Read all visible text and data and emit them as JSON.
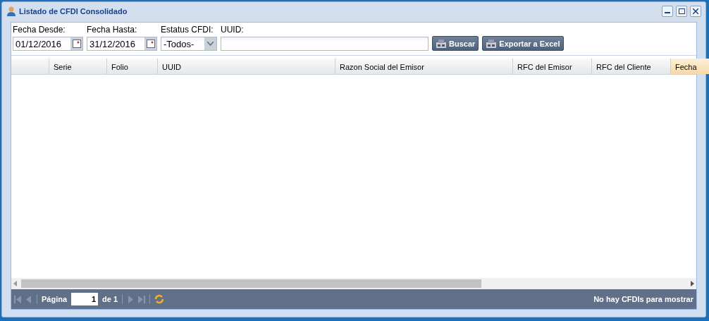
{
  "window": {
    "title": "Listado de CFDI Consolidado"
  },
  "filters": [
    {
      "label": "Fecha Desde:",
      "kind": "date",
      "value": "01/12/2016"
    },
    {
      "label": "Fecha Hasta:",
      "kind": "date",
      "value": "31/12/2016"
    },
    {
      "label": "Estatus CFDI:",
      "kind": "select",
      "value": "-Todos-"
    },
    {
      "label": "UUID:",
      "kind": "text"
    }
  ],
  "buttons": [
    "Buscar",
    "Exportar a Excel"
  ],
  "table": {
    "columns": [
      {
        "highlighted": false
      },
      {
        "label": "Serie",
        "highlighted": false
      },
      {
        "label": "Folio",
        "highlighted": false
      },
      {
        "label": "UUID",
        "highlighted": false
      },
      {
        "label": "Razon Social del Emisor",
        "highlighted": false
      },
      {
        "label": "RFC del Emisor",
        "highlighted": false
      },
      {
        "label": "RFC del Cliente",
        "highlighted": false
      },
      {
        "label": "Fecha",
        "highlighted": true
      }
    ]
  },
  "paging": {
    "page_label": "Página",
    "page": "1",
    "of": "de 1",
    "status": "No hay CFDIs para mostrar"
  }
}
